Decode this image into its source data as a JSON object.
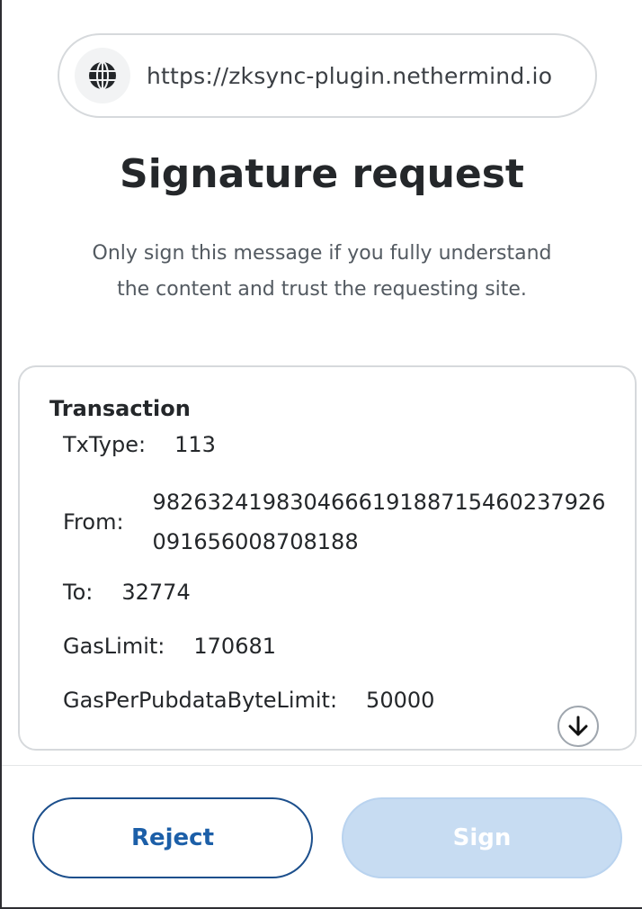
{
  "site": {
    "url": "https://zksync-plugin.nethermind.io",
    "icon": "globe-icon"
  },
  "title": "Signature request",
  "subtitle": "Only sign this message if you fully understand the content and trust the requesting site.",
  "transaction": {
    "heading": "Transaction",
    "fields": [
      {
        "label": "TxType:",
        "value": "113"
      },
      {
        "label": "From:",
        "value": "982632419830466619188715460237926091656008708188"
      },
      {
        "label": "To:",
        "value": "32774"
      },
      {
        "label": "GasLimit:",
        "value": "170681"
      },
      {
        "label": "GasPerPubdataByteLimit:",
        "value": "50000"
      }
    ],
    "scroll_icon": "arrow-down-icon"
  },
  "buttons": {
    "reject_label": "Reject",
    "sign_label": "Sign"
  },
  "colors": {
    "accent": "#1c5fa8",
    "sign_disabled_bg": "#c7dcf2",
    "border": "#d6d9dc"
  }
}
